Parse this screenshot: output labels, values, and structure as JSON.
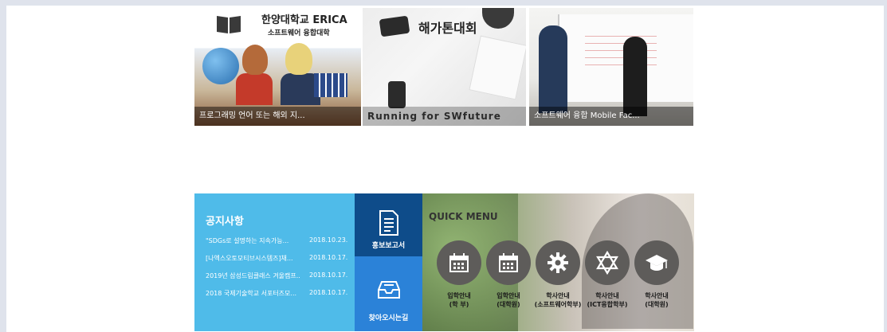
{
  "thumbnails": [
    {
      "title": "한양대학교 ERICA",
      "subtitle": "소프트웨어 융합대학",
      "caption": "프로그래밍 언어 또는 해외 지..."
    },
    {
      "title": "해가톤대회",
      "caption": "Running for SWfuture"
    },
    {
      "caption": "소프트웨어 융합 Mobile Fac..."
    }
  ],
  "notice": {
    "heading": "공지사항",
    "items": [
      {
        "title": "\"SDGs로 설명하는 지속가능...",
        "date": "2018.10.23."
      },
      {
        "title": "[나엑스오토모티브시스템즈]채...",
        "date": "2018.10.17."
      },
      {
        "title": "2019년 삼성드림클래스 겨울캠프...",
        "date": "2018.10.17."
      },
      {
        "title": "2018 국제기술학교 서포터즈모...",
        "date": "2018.10.17."
      }
    ]
  },
  "side_buttons": {
    "report": "홍보보고서",
    "directions": "찾아오시는길"
  },
  "quick_menu": {
    "heading": "QUICK MENU",
    "items": [
      {
        "icon": "calendar-icon",
        "line1": "입학안내",
        "line2": "(학 부)"
      },
      {
        "icon": "calendar-icon",
        "line1": "입학안내",
        "line2": "(대학원)"
      },
      {
        "icon": "gear-icon",
        "line1": "학사안내",
        "line2": "(소프트웨어학부)"
      },
      {
        "icon": "star-of-david-icon",
        "line1": "학사안내",
        "line2": "(ICT융합학부)"
      },
      {
        "icon": "graduation-cap-icon",
        "line1": "학사안내",
        "line2": "(대학원)"
      }
    ]
  },
  "colors": {
    "notice_bg": "#4fbbe9",
    "report_bg": "#0e4c8a",
    "directions_bg": "#2b82d8",
    "quick_circle": "#5e5c5a"
  }
}
